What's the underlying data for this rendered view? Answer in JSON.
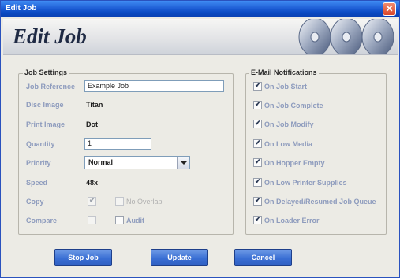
{
  "window": {
    "title": "Edit Job",
    "close_glyph": "✕"
  },
  "banner": {
    "title": "Edit Job"
  },
  "job_settings": {
    "title": "Job Settings",
    "job_reference": {
      "label": "Job Reference",
      "value": "Example Job"
    },
    "disc_image": {
      "label": "Disc Image",
      "value": "Titan"
    },
    "print_image": {
      "label": "Print Image",
      "value": "Dot"
    },
    "quantity": {
      "label": "Quantity",
      "value": "1"
    },
    "priority": {
      "label": "Priority",
      "value": "Normal"
    },
    "speed": {
      "label": "Speed",
      "value": "48x"
    },
    "copy": {
      "label": "Copy",
      "checked": true,
      "no_overlap_label": "No Overlap",
      "no_overlap_checked": false
    },
    "compare": {
      "label": "Compare",
      "checked": false,
      "audit_label": "Audit",
      "audit_checked": false
    }
  },
  "notifications": {
    "title": "E-Mail Notifications",
    "items": [
      {
        "label": "On Job Start",
        "checked": true
      },
      {
        "label": "On Job Complete",
        "checked": true
      },
      {
        "label": "On Job Modify",
        "checked": true
      },
      {
        "label": "On Low Media",
        "checked": true
      },
      {
        "label": "On Hopper Empty",
        "checked": true
      },
      {
        "label": "On Low Printer Supplies",
        "checked": true
      },
      {
        "label": "On Delayed/Resumed Job Queue",
        "checked": true
      },
      {
        "label": "On Loader Error",
        "checked": true
      }
    ]
  },
  "buttons": {
    "stop_job": "Stop Job",
    "update": "Update",
    "cancel": "Cancel"
  },
  "check_glyph": "✔",
  "colors": {
    "titlebar": "#1f5fd6",
    "label": "#8d9bbd",
    "button": "#3a6fd4"
  }
}
